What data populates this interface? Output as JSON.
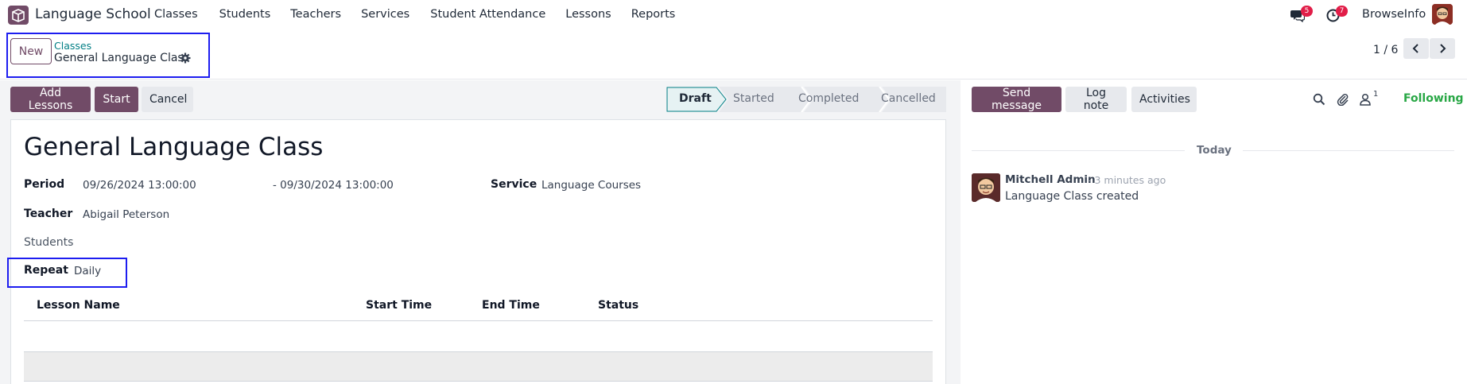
{
  "app": {
    "name": "Language School",
    "icon": "box-app-icon"
  },
  "menu": [
    "Classes",
    "Students",
    "Teachers",
    "Services",
    "Student Attendance",
    "Lessons",
    "Reports"
  ],
  "systray": {
    "messages_count": "5",
    "activities_count": "7",
    "user_name": "BrowseInfo"
  },
  "control": {
    "new_label": "New",
    "breadcrumb": "Classes",
    "record_title": "General Language Class",
    "pager": "1 / 6"
  },
  "actions": {
    "add_lessons": "Add Lessons",
    "start": "Start",
    "cancel": "Cancel"
  },
  "stages": [
    "Draft",
    "Started",
    "Completed",
    "Cancelled"
  ],
  "active_stage": "Draft",
  "form": {
    "title": "General Language Class",
    "period_label": "Period",
    "period_start": "09/26/2024 13:00:00",
    "period_end": "- 09/30/2024 13:00:00",
    "service_label": "Service",
    "service_value": "Language Courses",
    "teacher_label": "Teacher",
    "teacher_value": "Abigail Peterson",
    "students_label": "Students",
    "repeat_label": "Repeat",
    "repeat_value": "Daily",
    "table_headers": [
      "Lesson Name",
      "Start Time",
      "End Time",
      "Status"
    ]
  },
  "chatter": {
    "send_message": "Send message",
    "log_note": "Log note",
    "activities": "Activities",
    "followers_count": "1",
    "following": "Following",
    "date_separator": "Today",
    "message": {
      "author": "Mitchell Admin",
      "time": "- 3 minutes ago",
      "body": "Language Class created"
    }
  },
  "colors": {
    "brand": "#714b67",
    "link": "#017e84",
    "badge": "#e11d48",
    "following": "#28a745",
    "highlight": "#1d1df0"
  }
}
